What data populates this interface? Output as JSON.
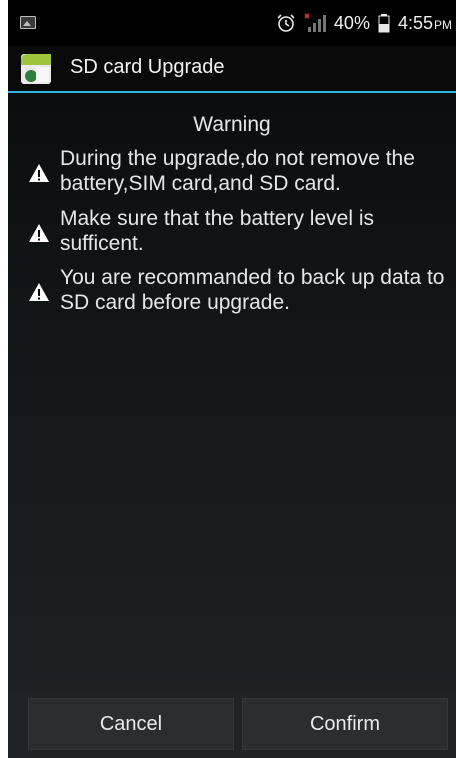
{
  "status_bar": {
    "battery_percent": "40%",
    "time": "4:55",
    "ampm": "PM",
    "icons": [
      "image-notification-icon",
      "alarm-icon",
      "signal-icon",
      "battery-icon"
    ]
  },
  "title_bar": {
    "title": "SD card Upgrade",
    "accent_color": "#33b5e5"
  },
  "content": {
    "heading": "Warning",
    "items": [
      {
        "icon": "warning-icon",
        "text": "During the upgrade,do not remove the battery,SIM card,and SD card."
      },
      {
        "icon": "warning-icon",
        "text": "Make sure that the battery level is sufficent."
      },
      {
        "icon": "warning-icon",
        "text": "You are recommanded to back up data to SD card before upgrade."
      }
    ]
  },
  "buttons": {
    "cancel": "Cancel",
    "confirm": "Confirm"
  }
}
